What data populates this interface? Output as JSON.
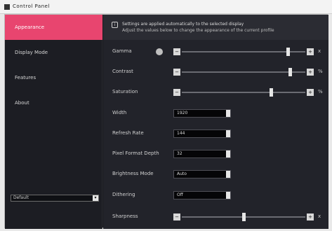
{
  "window": {
    "title": "Control Panel"
  },
  "sidebar": {
    "items": [
      {
        "label": "Appearance",
        "active": true
      },
      {
        "label": "Display Mode",
        "active": false
      },
      {
        "label": "Features",
        "active": false
      },
      {
        "label": "About",
        "active": false
      }
    ],
    "profile_select": {
      "value": "Default"
    }
  },
  "info": {
    "line1": "Settings are applied automatically to the selected display",
    "line2": "Adjust the values below to change the appearance of the current profile"
  },
  "sliders": [
    {
      "label": "Gamma",
      "unit": "x",
      "value_fraction": 0.87
    },
    {
      "label": "Contrast",
      "unit": "%",
      "value_fraction": 0.89
    },
    {
      "label": "Saturation",
      "unit": "%",
      "value_fraction": 0.73
    }
  ],
  "fields": [
    {
      "label": "Width",
      "value": "1920"
    },
    {
      "label": "Refresh Rate",
      "value": "144"
    },
    {
      "label": "Pixel Format Depth",
      "value": "32"
    },
    {
      "label": "Brightness Mode",
      "value": "Auto"
    },
    {
      "label": "Dithering",
      "value": "Off"
    }
  ],
  "bottom_slider": {
    "label": "Sharpness",
    "unit": "x",
    "value_fraction": 0.5
  },
  "colors": {
    "accent": "#e8456f",
    "sidebar_bg": "#1c1d23",
    "content_bg": "#22232a"
  }
}
